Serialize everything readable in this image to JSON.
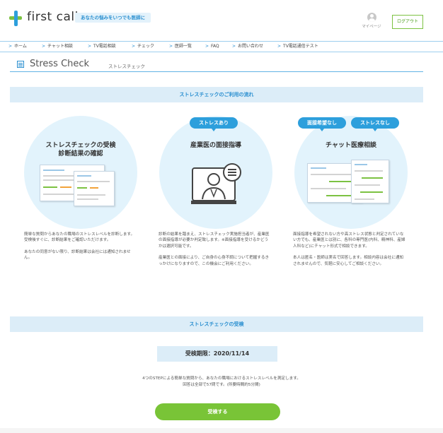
{
  "header": {
    "logo_text": "first call",
    "tagline": "あなたの悩みをいつでも医師に",
    "mypage_label": "マイページ",
    "logout_label": "ログアウト"
  },
  "nav": {
    "items": [
      {
        "label": "ホーム"
      },
      {
        "label": "チャット相談"
      },
      {
        "label": "TV電話相談"
      },
      {
        "label": "チェック"
      },
      {
        "label": "医師一覧"
      },
      {
        "label": "FAQ"
      },
      {
        "label": "お問い合わせ"
      },
      {
        "label": "TV電話通信テスト"
      }
    ]
  },
  "page": {
    "title": "Stress Check",
    "subtitle": "ストレスチェック"
  },
  "flow": {
    "section_title": "ストレスチェックのご利用の流れ",
    "steps": [
      {
        "title_line1": "ストレスチェックの受検",
        "title_line2": "診断結果の確認",
        "paragraphs": [
          "簡単な質問からあなたの職場のストレスレベルを診断します。受検後すぐに、診断結果をご確認いただけます。",
          "あなたの同意がない限り、診断結果は会社には通知されません。"
        ]
      },
      {
        "badge": "ストレスあり",
        "title_line1": "産業医の面接指導",
        "paragraphs": [
          "診断の結果を踏まえ、ストレスチェック実施担当者が、産業医の面接指導が必要か判定致します。※面接指導を受けるかどうかは選択可能です。",
          "産業医との面接により、ご自身の心身不調について把握するきっかけになりますので、この機会にご利用ください。"
        ]
      },
      {
        "badge_1": "面接希望なし",
        "badge_2": "ストレスなし",
        "title_line1": "チャット医療相談",
        "paragraphs": [
          "面接指導を希望されない方や高ストレス状態と判定されていない方でも、産業医とは別に、各科の専門医(内科、精神科、産婦人科など)にチャット形式で相談できます。",
          "本人は匿名・医師は実名で回答します。相談内容は会社に通知されませんので、気軽に安心してご相談ください。"
        ]
      }
    ]
  },
  "exam": {
    "section_title": "ストレスチェックの受検",
    "deadline": "受検期限：2020/11/14",
    "info_line1": "4つのSTEPによる簡単な質問から、あなたの職場におけるストレスレベルを測定します。",
    "info_line2": "回答は全部で57問です。(所要時間約5分間)",
    "start_label": "受検する"
  },
  "colors": {
    "accent_blue": "#2d9fdc",
    "accent_green": "#79c437",
    "band_bg": "#dcedf8",
    "circle_bg": "#e2f3fc"
  }
}
